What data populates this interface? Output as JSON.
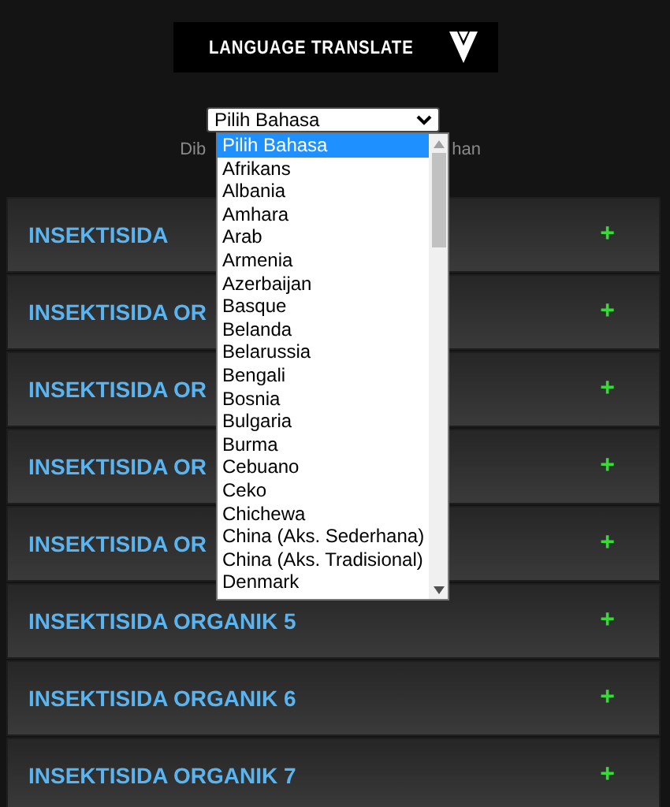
{
  "banner": {
    "title": "LANGUAGE TRANSLATE"
  },
  "language_select": {
    "value": "Pilih Bahasa",
    "expanded": true,
    "options": [
      {
        "label": "Pilih Bahasa",
        "selected": true
      },
      {
        "label": "Afrikans",
        "selected": false
      },
      {
        "label": "Albania",
        "selected": false
      },
      {
        "label": "Amhara",
        "selected": false
      },
      {
        "label": "Arab",
        "selected": false
      },
      {
        "label": "Armenia",
        "selected": false
      },
      {
        "label": "Azerbaijan",
        "selected": false
      },
      {
        "label": "Basque",
        "selected": false
      },
      {
        "label": "Belanda",
        "selected": false
      },
      {
        "label": "Belarussia",
        "selected": false
      },
      {
        "label": "Bengali",
        "selected": false
      },
      {
        "label": "Bosnia",
        "selected": false
      },
      {
        "label": "Bulgaria",
        "selected": false
      },
      {
        "label": "Burma",
        "selected": false
      },
      {
        "label": "Cebuano",
        "selected": false
      },
      {
        "label": "Ceko",
        "selected": false
      },
      {
        "label": "Chichewa",
        "selected": false
      },
      {
        "label": "China (Aks. Sederhana)",
        "selected": false
      },
      {
        "label": "China (Aks. Tradisional)",
        "selected": false
      },
      {
        "label": "Denmark",
        "selected": false
      }
    ]
  },
  "caption": {
    "left": "Dib",
    "right": "han"
  },
  "accordion": [
    {
      "title": "INSEKTISIDA",
      "icon": "+"
    },
    {
      "title": "INSEKTISIDA OR",
      "icon": "+"
    },
    {
      "title": "INSEKTISIDA OR",
      "icon": "+"
    },
    {
      "title": "INSEKTISIDA OR",
      "icon": "+"
    },
    {
      "title": "INSEKTISIDA OR",
      "icon": "+"
    },
    {
      "title": "INSEKTISIDA ORGANIK 5",
      "icon": "+"
    },
    {
      "title": "INSEKTISIDA ORGANIK 6",
      "icon": "+"
    },
    {
      "title": "INSEKTISIDA ORGANIK 7",
      "icon": "+"
    }
  ]
}
